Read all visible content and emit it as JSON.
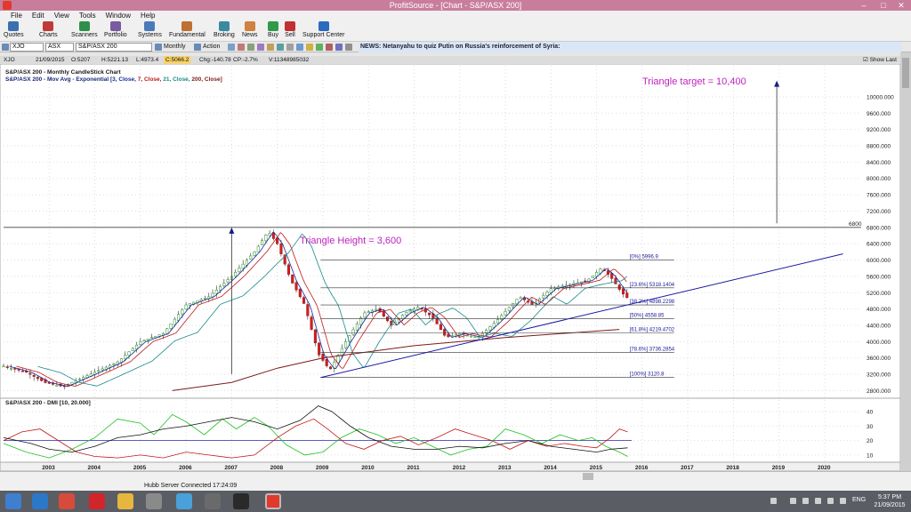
{
  "window": {
    "title": "ProfitSource - [Chart - S&P/ASX 200]"
  },
  "menu": [
    "File",
    "Edit",
    "View",
    "Tools",
    "Window",
    "Help"
  ],
  "toolbar": [
    {
      "label": "Quotes",
      "color": "#3b6fb0"
    },
    {
      "label": "Charts",
      "color": "#c03a3a"
    },
    {
      "label": "Scanners",
      "color": "#2f8f4a"
    },
    {
      "label": "Portfolio",
      "color": "#7a5aa0"
    },
    {
      "label": "Systems",
      "color": "#4a7ab8"
    },
    {
      "label": "Fundamental",
      "color": "#c07030"
    },
    {
      "label": "Broking",
      "color": "#3a8aa0"
    },
    {
      "label": "News",
      "color": "#d08040"
    },
    {
      "label": "Buy",
      "color": "#2f9a4a"
    },
    {
      "label": "Sell",
      "color": "#c03030"
    },
    {
      "label": "Support Center",
      "color": "#2a6ac0"
    }
  ],
  "symbolbar": {
    "symbol": "XJO",
    "exchange": "ASX",
    "name": "S&P/ASX 200",
    "period": "Monthly",
    "action": "Action"
  },
  "news": {
    "text": "NEWS: Netanyahu to quiz Putin on Russia's reinforcement of Syria:"
  },
  "infobar": {
    "symbol": "XJO",
    "date": "21/09/2015",
    "open": "O:5207",
    "high": "H:5221.13",
    "low": "L:4973.4",
    "close": "C:5066.2",
    "chg": "Chg:-140.78",
    "cp": "CP:-2.7%",
    "vol": "V:11348985032",
    "show_last": "Show Last"
  },
  "chart_header": {
    "line1": "S&P/ASX 200 - Monthly CandleStick Chart",
    "line2_prefix": "S&P/ASX 200 - Mov Avg - Exponential",
    "line2_params": [
      {
        "text": "[3, Close,",
        "color": "#1a2a9a"
      },
      {
        "text": "7, Close,",
        "color": "#c01818"
      },
      {
        "text": "21, Close,",
        "color": "#1a8a8a"
      },
      {
        "text": "200, Close]",
        "color": "#7a1a1a"
      }
    ]
  },
  "annotations": {
    "triangle_target": "Triangle target = 10,400",
    "triangle_height": "Triangle Height = 3,600",
    "level_6800": "6800",
    "annotation_color": "#c020c0"
  },
  "dmi_header": "S&P/ASX 200 - DMI [10, 20.000]",
  "status": {
    "text": "Hubb Server Connected 17:24:09"
  },
  "taskbar": {
    "lang": "ENG",
    "time": "5:37 PM",
    "date": "21/09/2015"
  },
  "chart_data": {
    "type": "candlestick",
    "title": "S&P/ASX 200 - Monthly CandleStick Chart",
    "x_range": [
      2002.0,
      2020.8
    ],
    "ylim": [
      2700,
      10500
    ],
    "yticks": [
      2800,
      3200,
      3600,
      4000,
      4400,
      4800,
      5200,
      5600,
      6000,
      6400,
      6800,
      7200,
      7600,
      8000,
      8400,
      8800,
      9200,
      9600,
      10000
    ],
    "yticks_label_format": "{v}.000",
    "year_ticks": [
      2003,
      2004,
      2005,
      2006,
      2007,
      2008,
      2009,
      2010,
      2011,
      2012,
      2013,
      2014,
      2015,
      2016,
      2017,
      2018,
      2019,
      2020
    ],
    "price_waypoints": [
      [
        2002.0,
        3400
      ],
      [
        2002.5,
        3250
      ],
      [
        2002.9,
        3000
      ],
      [
        2003.3,
        2900
      ],
      [
        2003.9,
        3200
      ],
      [
        2004.5,
        3500
      ],
      [
        2005.0,
        4000
      ],
      [
        2005.5,
        4200
      ],
      [
        2006.0,
        4900
      ],
      [
        2006.5,
        5100
      ],
      [
        2007.0,
        5600
      ],
      [
        2007.5,
        6200
      ],
      [
        2007.8,
        6700
      ],
      [
        2008.0,
        6400
      ],
      [
        2008.3,
        5500
      ],
      [
        2008.6,
        4900
      ],
      [
        2008.9,
        3700
      ],
      [
        2009.15,
        3300
      ],
      [
        2009.5,
        4000
      ],
      [
        2009.9,
        4700
      ],
      [
        2010.2,
        4800
      ],
      [
        2010.5,
        4400
      ],
      [
        2010.8,
        4700
      ],
      [
        2011.1,
        4850
      ],
      [
        2011.4,
        4600
      ],
      [
        2011.7,
        4100
      ],
      [
        2012.0,
        4200
      ],
      [
        2012.4,
        4100
      ],
      [
        2012.8,
        4500
      ],
      [
        2013.3,
        5100
      ],
      [
        2013.6,
        4900
      ],
      [
        2014.0,
        5300
      ],
      [
        2014.4,
        5400
      ],
      [
        2014.8,
        5500
      ],
      [
        2015.1,
        5800
      ],
      [
        2015.3,
        5600
      ],
      [
        2015.55,
        5200
      ],
      [
        2015.68,
        5066
      ]
    ],
    "ema": [
      {
        "name": "3",
        "color": "#1a2a9a",
        "lag": 0.12
      },
      {
        "name": "7",
        "color": "#c01818",
        "lag": 0.28
      },
      {
        "name": "21",
        "color": "#1a8a8a",
        "lag": 0.75
      }
    ],
    "ema200": {
      "name": "200",
      "color": "#7a1a1a",
      "points": [
        [
          2005.7,
          2800
        ],
        [
          2007.0,
          3000
        ],
        [
          2008.0,
          3350
        ],
        [
          2009.0,
          3600
        ],
        [
          2011.0,
          3900
        ],
        [
          2013.0,
          4100
        ],
        [
          2015.5,
          4300
        ]
      ]
    },
    "fib_levels": [
      {
        "label": "[0%] 5996.9",
        "value": 5996.9
      },
      {
        "label": "[23.6%] 5318.1404",
        "value": 5318.1404
      },
      {
        "label": "[38.2%] 4898.2298",
        "value": 4898.2298
      },
      {
        "label": "[50%] 4558.85",
        "value": 4558.85
      },
      {
        "label": "[61.8%] 4219.4702",
        "value": 4219.4702
      },
      {
        "label": "[78.6%] 3736.2854",
        "value": 3736.2854
      },
      {
        "label": "[100%] 3120.8",
        "value": 3120.8
      }
    ],
    "fib_x_range": [
      2008.95,
      2016.7
    ],
    "level_line": 6800,
    "trendline": [
      [
        2008.95,
        3120
      ],
      [
        2020.4,
        6150
      ]
    ],
    "height_arrow": {
      "x": 2007.0,
      "from": 3200,
      "to": 6800
    },
    "target_arrow": {
      "x": 2018.95,
      "from": 6900,
      "to": 10400
    },
    "dmi": {
      "ylim": [
        5,
        45
      ],
      "yticks": [
        10,
        20,
        30,
        40
      ],
      "adx_level": 20,
      "series": [
        {
          "name": "+DI",
          "color": "#20c020",
          "points": [
            [
              2002.0,
              18
            ],
            [
              2002.5,
              12
            ],
            [
              2003.0,
              8
            ],
            [
              2003.5,
              14
            ],
            [
              2004.0,
              22
            ],
            [
              2004.5,
              35
            ],
            [
              2005.0,
              32
            ],
            [
              2005.3,
              24
            ],
            [
              2005.7,
              38
            ],
            [
              2006.0,
              33
            ],
            [
              2006.4,
              24
            ],
            [
              2006.8,
              35
            ],
            [
              2007.1,
              28
            ],
            [
              2007.5,
              36
            ],
            [
              2007.8,
              30
            ],
            [
              2008.2,
              17
            ],
            [
              2008.6,
              10
            ],
            [
              2009.0,
              12
            ],
            [
              2009.4,
              22
            ],
            [
              2009.8,
              28
            ],
            [
              2010.2,
              24
            ],
            [
              2010.6,
              18
            ],
            [
              2011.0,
              22
            ],
            [
              2011.4,
              16
            ],
            [
              2011.8,
              10
            ],
            [
              2012.2,
              14
            ],
            [
              2012.6,
              16
            ],
            [
              2013.0,
              28
            ],
            [
              2013.4,
              24
            ],
            [
              2013.8,
              18
            ],
            [
              2014.2,
              24
            ],
            [
              2014.6,
              20
            ],
            [
              2014.9,
              22
            ],
            [
              2015.2,
              16
            ],
            [
              2015.5,
              12
            ],
            [
              2015.68,
              9
            ]
          ]
        },
        {
          "name": "-DI",
          "color": "#c01818",
          "points": [
            [
              2002.0,
              20
            ],
            [
              2002.4,
              26
            ],
            [
              2002.8,
              28
            ],
            [
              2003.2,
              20
            ],
            [
              2003.6,
              12
            ],
            [
              2004.0,
              9
            ],
            [
              2004.5,
              8
            ],
            [
              2005.0,
              10
            ],
            [
              2005.5,
              8
            ],
            [
              2006.0,
              12
            ],
            [
              2006.5,
              10
            ],
            [
              2007.0,
              8
            ],
            [
              2007.5,
              10
            ],
            [
              2008.0,
              22
            ],
            [
              2008.4,
              30
            ],
            [
              2008.8,
              35
            ],
            [
              2009.1,
              28
            ],
            [
              2009.5,
              18
            ],
            [
              2009.9,
              14
            ],
            [
              2010.3,
              20
            ],
            [
              2010.7,
              23
            ],
            [
              2011.1,
              17
            ],
            [
              2011.5,
              22
            ],
            [
              2011.9,
              28
            ],
            [
              2012.3,
              24
            ],
            [
              2012.7,
              20
            ],
            [
              2013.1,
              14
            ],
            [
              2013.5,
              20
            ],
            [
              2013.9,
              16
            ],
            [
              2014.3,
              18
            ],
            [
              2014.7,
              16
            ],
            [
              2015.0,
              15
            ],
            [
              2015.3,
              22
            ],
            [
              2015.5,
              28
            ],
            [
              2015.68,
              26
            ]
          ]
        },
        {
          "name": "ADX",
          "color": "#111111",
          "points": [
            [
              2002.0,
              22
            ],
            [
              2002.6,
              18
            ],
            [
              2003.0,
              14
            ],
            [
              2003.5,
              12
            ],
            [
              2004.0,
              16
            ],
            [
              2004.5,
              22
            ],
            [
              2005.0,
              24
            ],
            [
              2005.5,
              28
            ],
            [
              2006.0,
              30
            ],
            [
              2006.5,
              33
            ],
            [
              2007.0,
              36
            ],
            [
              2007.5,
              33
            ],
            [
              2008.0,
              28
            ],
            [
              2008.5,
              34
            ],
            [
              2008.9,
              44
            ],
            [
              2009.2,
              40
            ],
            [
              2009.6,
              30
            ],
            [
              2010.0,
              22
            ],
            [
              2010.5,
              16
            ],
            [
              2011.0,
              14
            ],
            [
              2011.5,
              14
            ],
            [
              2012.0,
              16
            ],
            [
              2012.5,
              15
            ],
            [
              2013.0,
              18
            ],
            [
              2013.5,
              20
            ],
            [
              2014.0,
              16
            ],
            [
              2014.5,
              14
            ],
            [
              2015.0,
              12
            ],
            [
              2015.3,
              14
            ],
            [
              2015.68,
              15
            ]
          ]
        }
      ]
    }
  }
}
